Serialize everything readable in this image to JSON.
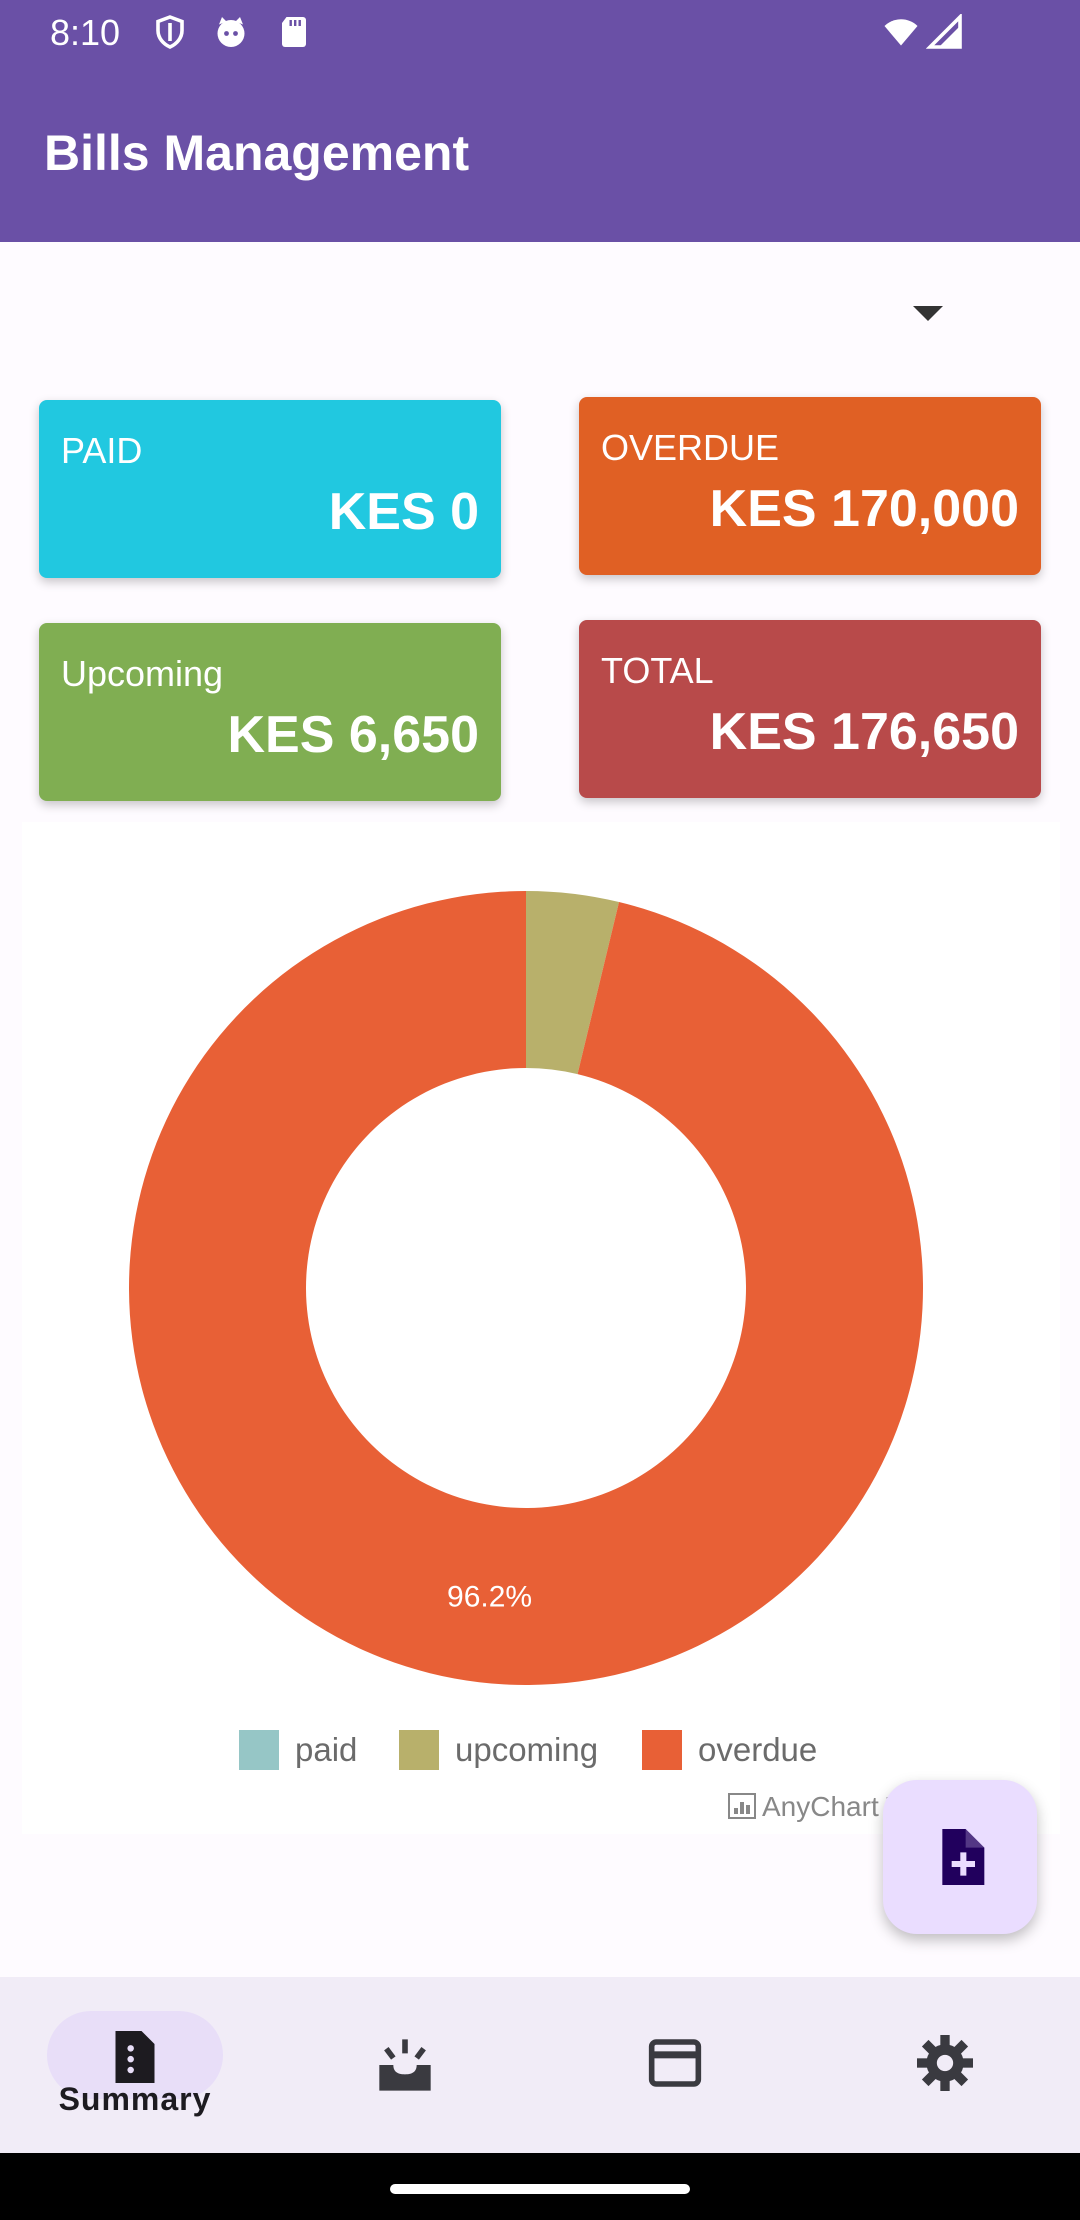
{
  "status_bar": {
    "time": "8:10"
  },
  "app_bar": {
    "title": "Bills Management"
  },
  "cards": [
    {
      "label": "PAID",
      "value": "KES 0",
      "color": "#21c8e0"
    },
    {
      "label": "OVERDUE",
      "value": "KES 170,000",
      "color": "#e06024"
    },
    {
      "label": "Upcoming",
      "value": "KES 6,650",
      "color": "#80ae52"
    },
    {
      "label": "TOTAL",
      "value": "KES 176,650",
      "color": "#b84a4a"
    }
  ],
  "chart_data": {
    "type": "pie",
    "donut": true,
    "labels": [
      "paid",
      "upcoming",
      "overdue"
    ],
    "values": [
      0,
      6650,
      170000
    ],
    "colors": [
      "#96c6c6",
      "#b8b06b",
      "#e86036"
    ],
    "slice_label": "96.2%",
    "legend_position": "bottom",
    "credit": "AnyChart T"
  },
  "fab": {
    "icon": "add-document-icon"
  },
  "bottom_nav": {
    "items": [
      {
        "label": "Summary",
        "icon": "summary-document-icon",
        "active": true
      },
      {
        "label": "",
        "icon": "inbox-icon"
      },
      {
        "label": "",
        "icon": "credit-card-icon"
      },
      {
        "label": "",
        "icon": "settings-gear-icon"
      }
    ]
  }
}
